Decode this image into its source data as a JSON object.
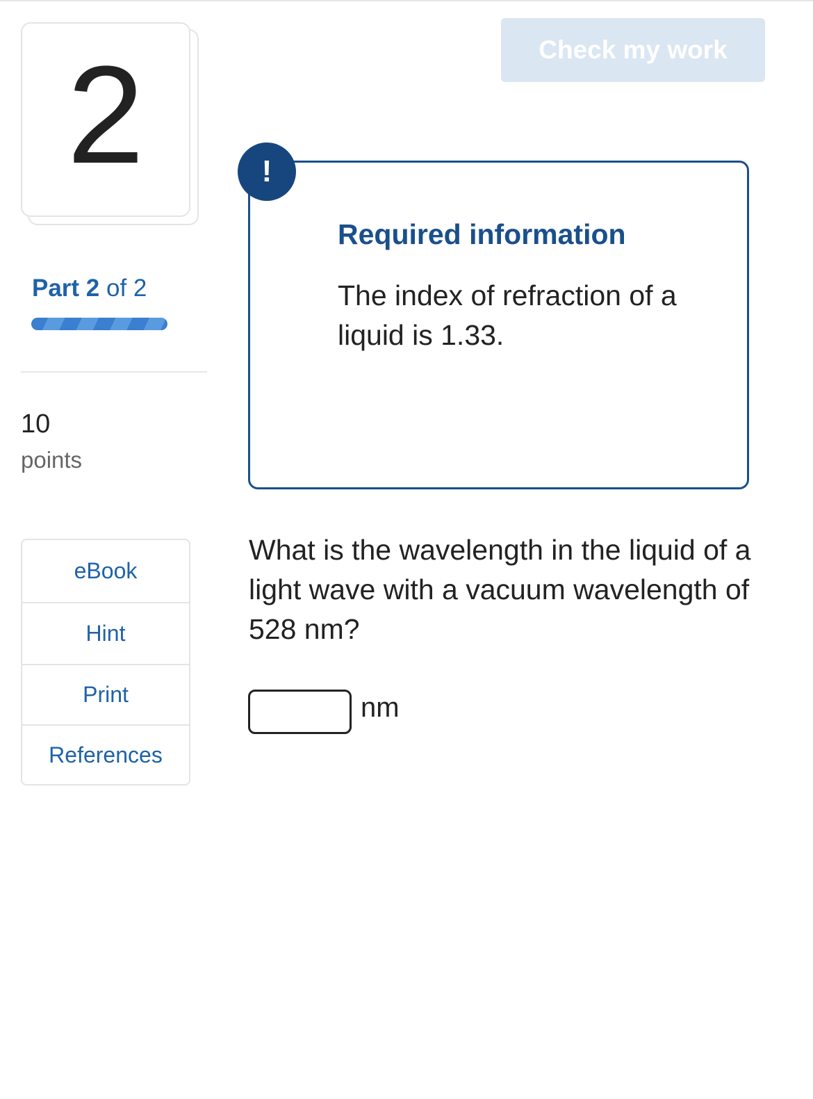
{
  "question": {
    "number": "2",
    "part_bold": "Part 2",
    "part_rest": " of 2",
    "progress_fraction": 1.0,
    "points_value": "10",
    "points_label": "points",
    "text": "What is the wavelength in the liquid of a light wave with a vacuum wavelength of 528 nm?",
    "answer_value": "",
    "unit": "nm"
  },
  "tools": [
    "eBook",
    "Hint",
    "Print",
    "References"
  ],
  "check_button_label": "Check my work",
  "required_info": {
    "badge": "!",
    "title": "Required information",
    "text": "The index of refraction of a liquid is 1.33."
  },
  "colors": {
    "accent_blue": "#1f62a8",
    "info_border": "#1a4f8b",
    "badge_bg": "#17467e",
    "check_button_bg": "#dbe6f3"
  }
}
